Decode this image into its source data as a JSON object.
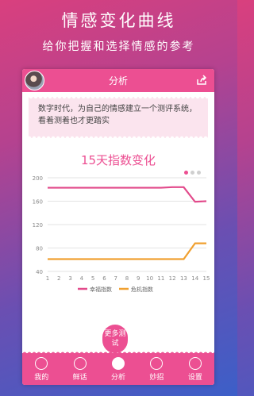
{
  "promo": {
    "title": "情感变化曲线",
    "subtitle": "给你把握和选择情感的参考"
  },
  "app": {
    "title": "分析"
  },
  "intro_text": "数字时代，为自己的情感建立一个测评系统，看着测着也才更踏实",
  "chart_title": "15天指数变化",
  "more_button": "更多测试",
  "nav": [
    "我的",
    "鲜话",
    "分析",
    "妙招",
    "设置"
  ],
  "colors": {
    "accent": "#ec4f92",
    "happy": "#e24a8b",
    "crisis": "#f0a030"
  },
  "chart_data": {
    "type": "line",
    "x": [
      1,
      2,
      3,
      4,
      5,
      6,
      7,
      8,
      9,
      10,
      11,
      12,
      13,
      14,
      15
    ],
    "ylim": [
      40,
      200
    ],
    "yticks": [
      40,
      80,
      120,
      160,
      200
    ],
    "grid": true,
    "legend_placement": "bottom",
    "series": [
      {
        "name": "幸福指数",
        "color": "#e24a8b",
        "values": [
          183,
          183,
          183,
          183,
          183,
          183,
          183,
          183,
          183,
          183,
          183,
          184,
          184,
          159,
          160
        ]
      },
      {
        "name": "危机指数",
        "color": "#f0a030",
        "values": [
          61,
          61,
          61,
          61,
          61,
          61,
          61,
          61,
          61,
          61,
          61,
          61,
          61,
          88,
          88
        ]
      }
    ]
  }
}
